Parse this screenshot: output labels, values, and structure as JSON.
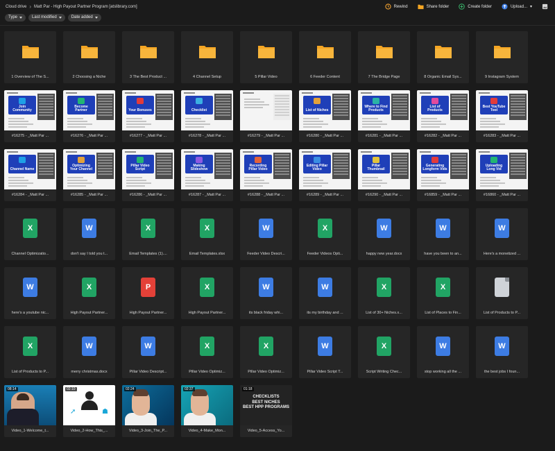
{
  "breadcrumb": {
    "root": "Cloud drive",
    "current": "Matt Par - High Payout Partner Program [atslibrary.com]"
  },
  "actions": {
    "rewind": "Rewind",
    "share": "Share folder",
    "create": "Create folder",
    "upload": "Upload..."
  },
  "filters": [
    "Type",
    "Last modified",
    "Date added"
  ],
  "colors": {
    "background": "#1b1b1b",
    "tile": "#262626",
    "folder": "#f5a623",
    "excel": "#21a464",
    "word": "#3d7ce3",
    "pdf": "#e34138"
  },
  "items": [
    {
      "kind": "folder",
      "label": "1 Overview of The S..."
    },
    {
      "kind": "folder",
      "label": "2 Choosing a Niche"
    },
    {
      "kind": "folder",
      "label": "3 The Best Product ..."
    },
    {
      "kind": "folder",
      "label": "4 Channel Setup"
    },
    {
      "kind": "folder",
      "label": "5 Pillar Video"
    },
    {
      "kind": "folder",
      "label": "6 Feeder Content"
    },
    {
      "kind": "folder",
      "label": "7 The Bridge Page"
    },
    {
      "kind": "folder",
      "label": "8 Organic Email Sys..."
    },
    {
      "kind": "folder",
      "label": "9 Instagram System"
    },
    {
      "kind": "shot",
      "label": "#16275 - _Matt Par ...",
      "caption": "Join Community",
      "art": "#1ea0e6"
    },
    {
      "kind": "shot",
      "label": "#16276 - _Matt Par ...",
      "caption": "Become Partner",
      "art": "#22b573"
    },
    {
      "kind": "shot",
      "label": "#16277 - _Matt Par ...",
      "caption": "Your Bonuses",
      "art": "#e23b3b"
    },
    {
      "kind": "shot",
      "label": "#16278 - _Matt Par ...",
      "caption": "Checklist",
      "art": "#3bb0e2"
    },
    {
      "kind": "shot",
      "label": "#16279 - _Matt Par ...",
      "caption": "",
      "art": "#cccccc",
      "doclike": true
    },
    {
      "kind": "shot",
      "label": "#16280 - _Matt Par ...",
      "caption": "List of Niches",
      "art": "#e2a13b"
    },
    {
      "kind": "shot",
      "label": "#16281 - _Matt Par ...",
      "caption": "Where to Find Products",
      "art": "#2bb3a6"
    },
    {
      "kind": "shot",
      "label": "#16282 - _Matt Par ...",
      "caption": "List of Products",
      "art": "#e24b9d"
    },
    {
      "kind": "shot",
      "label": "#16283 - _Matt Par ...",
      "caption": "Best YouTube Tool",
      "art": "#e23b3b"
    },
    {
      "kind": "shot",
      "label": "#16284 - _Matt Par ...",
      "caption": "Channel Name",
      "art": "#1ea0e6"
    },
    {
      "kind": "shot",
      "label": "#16285 - _Matt Par ...",
      "caption": "Optimizing Your Channel",
      "art": "#e2a13b"
    },
    {
      "kind": "shot",
      "label": "#16286 - _Matt Par ...",
      "caption": "Pillar Video Script",
      "art": "#22b573"
    },
    {
      "kind": "shot",
      "label": "#16287 - _Matt Par ...",
      "caption": "Making Slideshow",
      "art": "#8e5ae2"
    },
    {
      "kind": "shot",
      "label": "#16288 - _Matt Par ...",
      "caption": "Recording Pillar Video",
      "art": "#e2623b"
    },
    {
      "kind": "shot",
      "label": "#16289 - _Matt Par ...",
      "caption": "Editing Pillar Video",
      "art": "#3b8ee2"
    },
    {
      "kind": "shot",
      "label": "#16290 - _Matt Par ...",
      "caption": "Pillar Thumbnail",
      "art": "#e2c33b"
    },
    {
      "kind": "shot",
      "label": "#16859 - _Matt Par ...",
      "caption": "Generating Longform Vids",
      "art": "#e23b3b"
    },
    {
      "kind": "shot",
      "label": "#16860 - _Matt Par ...",
      "caption": "Uploading Long Vid",
      "art": "#22b573"
    },
    {
      "kind": "excel",
      "label": "Channel Optimizatio..."
    },
    {
      "kind": "word",
      "label": "don't say I told you t..."
    },
    {
      "kind": "excel",
      "label": "Email Templates (1)...."
    },
    {
      "kind": "excel",
      "label": "Email Templates.xlsx"
    },
    {
      "kind": "word",
      "label": "Feeder Video Descri..."
    },
    {
      "kind": "excel",
      "label": "Feeder Videos Opti..."
    },
    {
      "kind": "word",
      "label": "happy new year.docx"
    },
    {
      "kind": "word",
      "label": "have you been to an..."
    },
    {
      "kind": "word",
      "label": "Here's a monetized ..."
    },
    {
      "kind": "word",
      "label": "here's a youtube nic..."
    },
    {
      "kind": "excel",
      "label": "High Payout Partner..."
    },
    {
      "kind": "pdf",
      "label": "High Payout Partner..."
    },
    {
      "kind": "excel",
      "label": "High Payout Partner..."
    },
    {
      "kind": "word",
      "label": "its black friday whi..."
    },
    {
      "kind": "word",
      "label": "its my birthday and ..."
    },
    {
      "kind": "excel",
      "label": "List of 30+ Niches.x..."
    },
    {
      "kind": "excel",
      "label": "List of Places to Fin..."
    },
    {
      "kind": "generic",
      "label": "List of Products to P..."
    },
    {
      "kind": "excel",
      "label": "List of Products to P..."
    },
    {
      "kind": "word",
      "label": "merry christmas.docx"
    },
    {
      "kind": "word",
      "label": "Pillar Video Descript..."
    },
    {
      "kind": "excel",
      "label": "Pillar Video Optimiz..."
    },
    {
      "kind": "excel",
      "label": "Pillar Video Optimiz..."
    },
    {
      "kind": "word",
      "label": "Pillar Video Script T..."
    },
    {
      "kind": "excel",
      "label": "Script Writing Chec..."
    },
    {
      "kind": "word",
      "label": "stop working all the ..."
    },
    {
      "kind": "word",
      "label": "the best jobs I foun..."
    },
    {
      "kind": "video",
      "style": "v1",
      "duration": "08:14",
      "label": "Video_1-Welcome_t..."
    },
    {
      "kind": "video",
      "style": "v2",
      "duration": "02:10",
      "label": "Video_2-How_This_..."
    },
    {
      "kind": "video",
      "style": "v3",
      "duration": "02:24",
      "label": "Video_3-Join_The_P..."
    },
    {
      "kind": "video",
      "style": "v4",
      "duration": "02:37",
      "label": "Video_4-Make_Mon..."
    },
    {
      "kind": "video",
      "style": "v5",
      "duration": "01:18",
      "label": "Video_5-Access_Yo...",
      "overlay": [
        "CHECKLISTS",
        "BEST NICHES",
        "BEST HPP PROGRAMS"
      ]
    }
  ]
}
